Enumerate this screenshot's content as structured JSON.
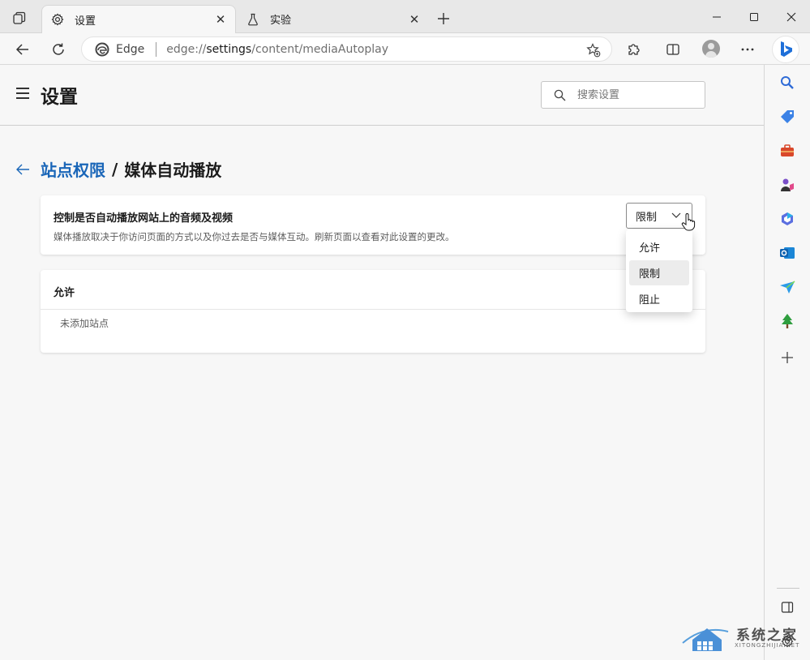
{
  "tabs": [
    {
      "title": "设置",
      "icon": "gear-icon",
      "active": true
    },
    {
      "title": "实验",
      "icon": "flask-icon",
      "active": false
    }
  ],
  "addressbar": {
    "brand": "Edge",
    "url_prefix": "edge://",
    "url_host": "settings",
    "url_path": "/content/mediaAutoplay"
  },
  "header": {
    "title": "设置",
    "search_placeholder": "搜索设置"
  },
  "breadcrumb": {
    "parent": "站点权限",
    "separator": "/",
    "current": "媒体自动播放"
  },
  "autoplay_setting": {
    "title": "控制是否自动播放网站上的音频及视频",
    "description": "媒体播放取决于你访问页面的方式以及你过去是否与媒体互动。刷新页面以查看对此设置的更改。",
    "selected_value": "限制",
    "options": [
      "允许",
      "限制",
      "阻止"
    ]
  },
  "allow_section": {
    "title": "允许",
    "empty_text": "未添加站点"
  },
  "watermark": {
    "text": "系统之家",
    "sub": "XITONGZHIJIA.NET"
  },
  "colors": {
    "accent": "#1a66b8",
    "background": "#f7f7f7"
  }
}
